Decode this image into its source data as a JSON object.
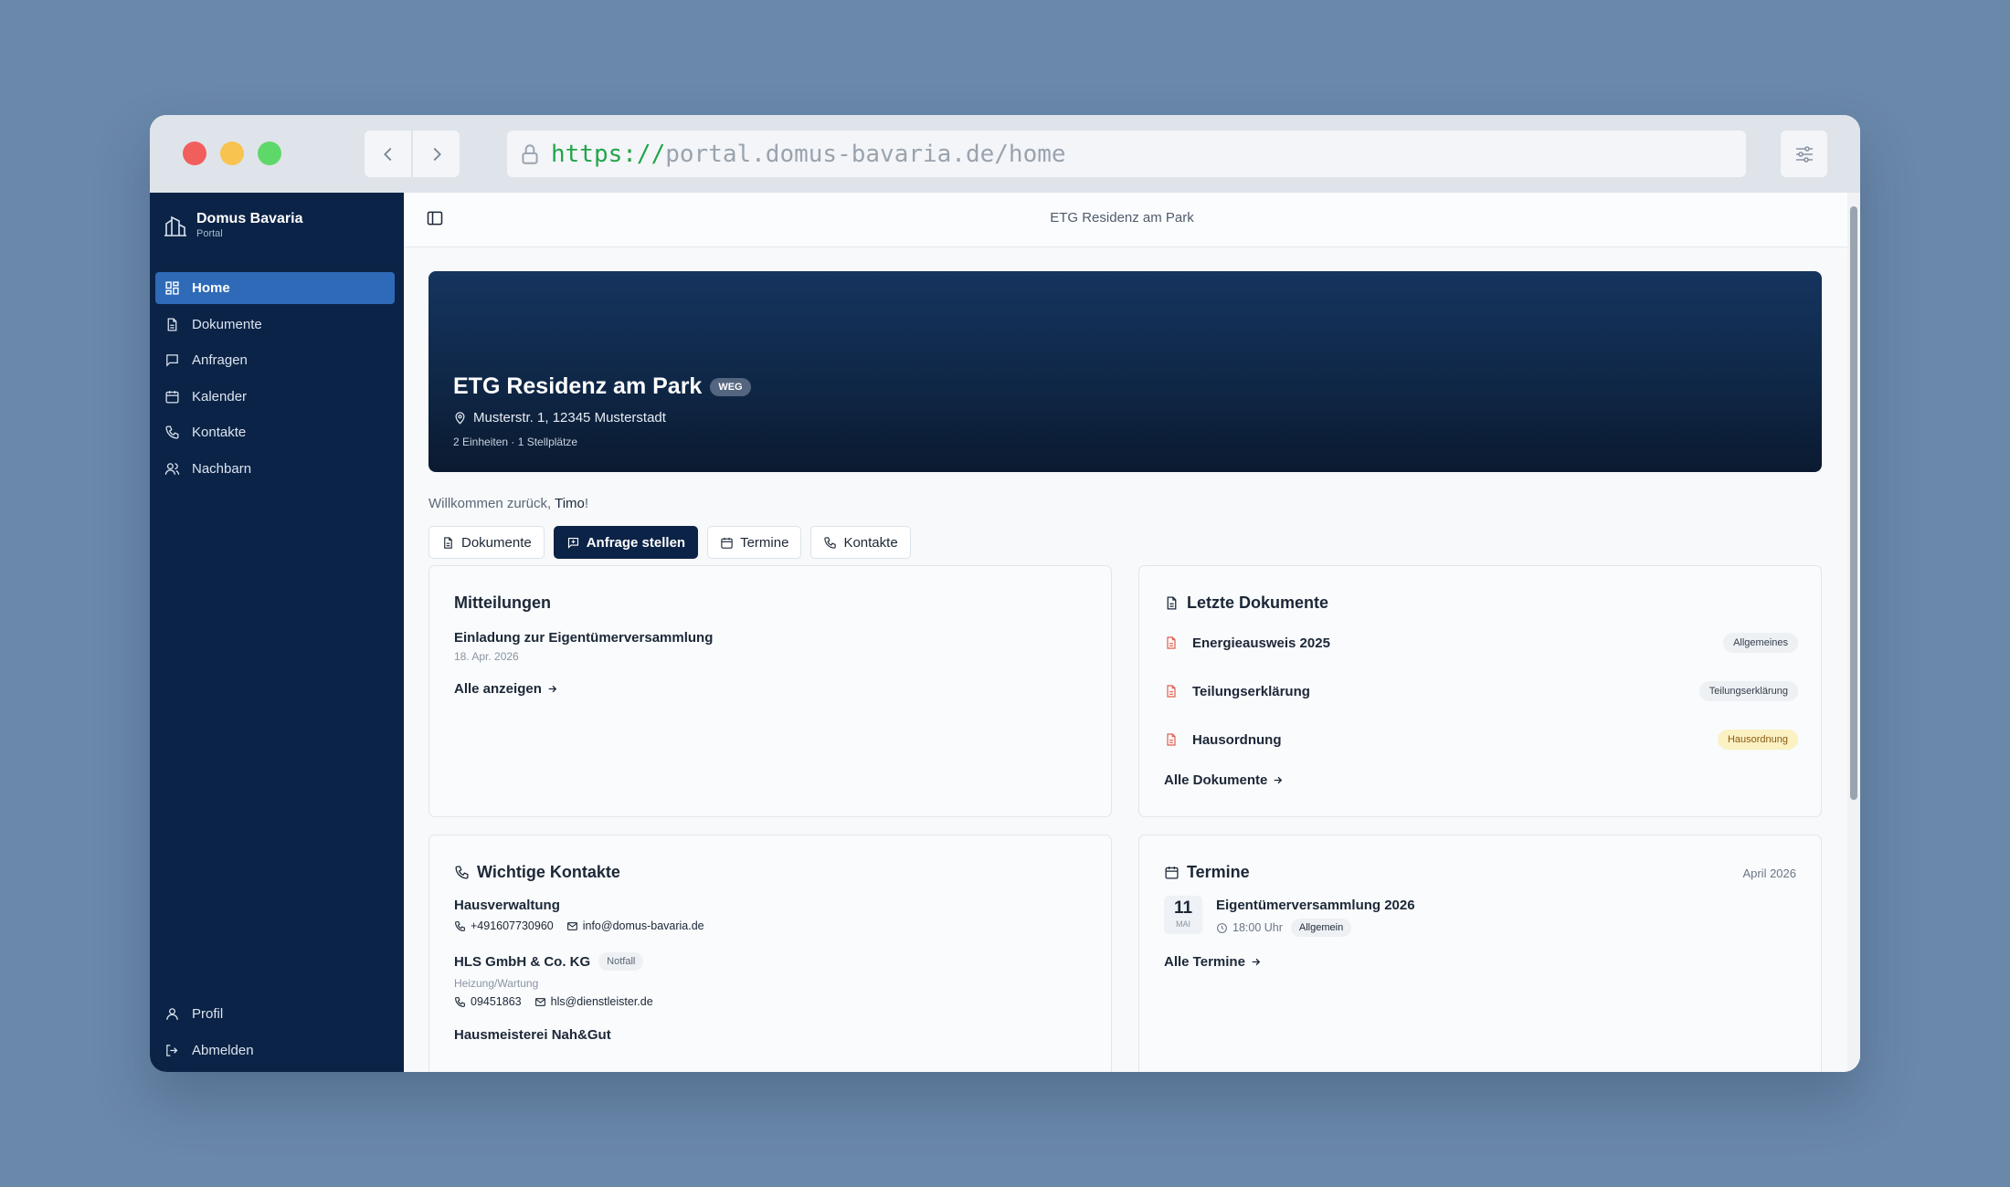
{
  "browser": {
    "url_scheme": "https://",
    "url_rest": "portal.domus-bavaria.de/home"
  },
  "sidebar": {
    "brand_title": "Domus Bavaria",
    "brand_sub": "Portal",
    "items": [
      {
        "label": "Home",
        "icon": "grid-icon",
        "active": true
      },
      {
        "label": "Dokumente",
        "icon": "file-icon"
      },
      {
        "label": "Anfragen",
        "icon": "message-icon"
      },
      {
        "label": "Kalender",
        "icon": "calendar-icon"
      },
      {
        "label": "Kontakte",
        "icon": "phone-icon"
      },
      {
        "label": "Nachbarn",
        "icon": "users-icon"
      }
    ],
    "bottom": [
      {
        "label": "Profil",
        "icon": "user-icon"
      },
      {
        "label": "Abmelden",
        "icon": "logout-icon"
      }
    ]
  },
  "topbar": {
    "title": "ETG Residenz am Park"
  },
  "hero": {
    "title": "ETG Residenz am Park",
    "badge": "WEG",
    "address": "Musterstr. 1, 12345 Musterstadt",
    "units": "2 Einheiten · 1 Stellplätze"
  },
  "welcome": {
    "prefix": "Willkommen zurück, ",
    "name": "Timo",
    "suffix": "!"
  },
  "actions": [
    {
      "label": "Dokumente",
      "icon": "file-icon"
    },
    {
      "label": "Anfrage stellen",
      "icon": "message-icon",
      "primary": true
    },
    {
      "label": "Termine",
      "icon": "calendar-icon"
    },
    {
      "label": "Kontakte",
      "icon": "phone-icon"
    }
  ],
  "mitteilungen": {
    "title": "Mitteilungen",
    "item_title": "Einladung zur Eigentümerversammlung",
    "item_date": "18. Apr. 2026",
    "link": "Alle anzeigen"
  },
  "dokumente": {
    "title": "Letzte Dokumente",
    "items": [
      {
        "name": "Energieausweis 2025",
        "tag": "Allgemeines"
      },
      {
        "name": "Teilungserklärung",
        "tag": "Teilungserklärung"
      },
      {
        "name": "Hausordnung",
        "tag": "Hausordnung",
        "tag_color": "#fbf1c2"
      }
    ],
    "link": "Alle Dokumente"
  },
  "kontakte": {
    "title": "Wichtige Kontakte",
    "items": [
      {
        "name": "Hausverwaltung",
        "phone": "+491607730960",
        "email": "info@domus-bavaria.de"
      },
      {
        "name": "HLS GmbH & Co. KG",
        "tag": "Notfall",
        "sub": "Heizung/Wartung",
        "phone": "09451863",
        "email": "hls@dienstleister.de"
      },
      {
        "name": "Hausmeisterei Nah&Gut"
      }
    ]
  },
  "termine": {
    "title": "Termine",
    "month": "April 2026",
    "event": {
      "day": "11",
      "mon": "MAI",
      "title": "Eigentümerversammlung 2026",
      "time": "18:00 Uhr",
      "tag": "Allgemein"
    },
    "link": "Alle Termine"
  },
  "colors": {
    "sidebar": "#0b2346",
    "accent": "#2e6ab8",
    "doc_icon": "#e35d4f"
  }
}
